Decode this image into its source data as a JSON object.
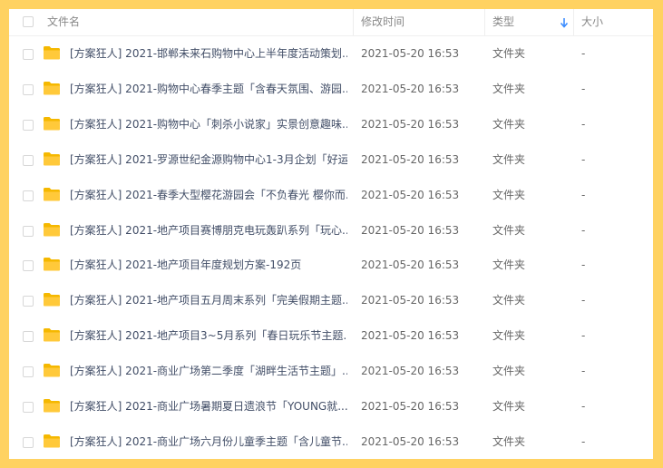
{
  "header": {
    "name_label": "文件名",
    "time_label": "修改时间",
    "type_label": "类型",
    "size_label": "大小",
    "sort_icon": "arrow-down-icon"
  },
  "colors": {
    "background": "#ffd261",
    "folder": "#ffc93a",
    "sort_arrow": "#3b8cff"
  },
  "rows": [
    {
      "name": "[方案狂人] 2021-邯郸未来石购物中心上半年度活动策划...",
      "time": "2021-05-20 16:53",
      "type": "文件夹",
      "size": "-"
    },
    {
      "name": "[方案狂人] 2021-购物中心春季主题「含春天氛围、游园...",
      "time": "2021-05-20 16:53",
      "type": "文件夹",
      "size": "-"
    },
    {
      "name": "[方案狂人] 2021-购物中心「刺杀小说家」实景创意趣味...",
      "time": "2021-05-20 16:53",
      "type": "文件夹",
      "size": "-"
    },
    {
      "name": "[方案狂人] 2021-罗源世纪金源购物中心1-3月企划「好运...",
      "time": "2021-05-20 16:53",
      "type": "文件夹",
      "size": "-"
    },
    {
      "name": "[方案狂人] 2021-春季大型樱花游园会「不负春光 樱你而...",
      "time": "2021-05-20 16:53",
      "type": "文件夹",
      "size": "-"
    },
    {
      "name": "[方案狂人] 2021-地产项目赛博朋克电玩轰趴系列「玩心...",
      "time": "2021-05-20 16:53",
      "type": "文件夹",
      "size": "-"
    },
    {
      "name": "[方案狂人] 2021-地产项目年度规划方案-192页",
      "time": "2021-05-20 16:53",
      "type": "文件夹",
      "size": "-"
    },
    {
      "name": "[方案狂人] 2021-地产项目五月周末系列「完美假期主题...",
      "time": "2021-05-20 16:53",
      "type": "文件夹",
      "size": "-"
    },
    {
      "name": "[方案狂人] 2021-地产项目3~5月系列「春日玩乐节主题...",
      "time": "2021-05-20 16:53",
      "type": "文件夹",
      "size": "-"
    },
    {
      "name": "[方案狂人] 2021-商业广场第二季度「湖畔生活节主题」...",
      "time": "2021-05-20 16:53",
      "type": "文件夹",
      "size": "-"
    },
    {
      "name": "[方案狂人] 2021-商业广场暑期夏日遗浪节「YOUNG就...",
      "time": "2021-05-20 16:53",
      "type": "文件夹",
      "size": "-"
    },
    {
      "name": "[方案狂人] 2021-商业广场六月份儿童季主题「含儿童节...",
      "time": "2021-05-20 16:53",
      "type": "文件夹",
      "size": "-"
    }
  ]
}
